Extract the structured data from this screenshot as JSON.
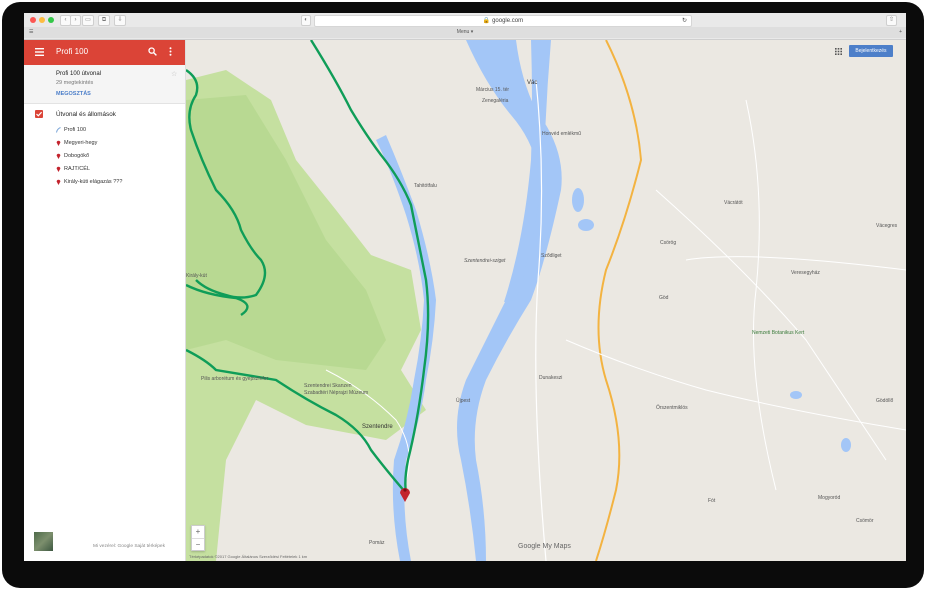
{
  "browser": {
    "url": "google.com",
    "tab_label": "Menu ▾",
    "tab_icon": "sidebar-icon"
  },
  "sidebar": {
    "title": "Profi 100",
    "map_title": "Profi 100 útvonal",
    "views": "29 megtekintés",
    "share": "MEGOSZTÁS",
    "layer_title": "Útvonal és állomások",
    "items": [
      {
        "label": "Profi 100",
        "icon": "route-icon"
      },
      {
        "label": "Megyeri-hegy",
        "icon": "pin-icon"
      },
      {
        "label": "Dobogókő",
        "icon": "pin-icon"
      },
      {
        "label": "RAJT/CÉL",
        "icon": "pin-icon"
      },
      {
        "label": "Király-kúti elágazás ???",
        "icon": "pin-icon"
      }
    ],
    "footer": "Mi vezérel: Google Saját térképek"
  },
  "map": {
    "signin": "Bejelentkezés",
    "branding": "Google My Maps",
    "attribution": "Térképadatok ©2017 Google   Általános Szerződési Feltételek   1 km",
    "labels": {
      "vac": "Vác",
      "marcius": "Március 15. tér",
      "zenegalerian": "Zenegaléria",
      "honved": "Honvéd emlékmű",
      "tahitotfalu": "Tahitótfalu",
      "szentendrei_sziget": "Szentendrei-sziget",
      "szodliget": "Sződliget",
      "veresegyhaz": "Veresegyház",
      "csoerog": "Csörög",
      "vacratot": "Vácrátót",
      "vacegres": "Vácegres",
      "god": "Göd",
      "vacratot_kert": "Nemzeti Botanikus Kert",
      "szentendre": "Szentendre",
      "skanzen": "Szentendrei Skanzen",
      "szentendrei_muzeum": "Szabadtéri Néprajzi Múzeum",
      "dunakeszi": "Dunakeszi",
      "gödöllő": "Gödöllő",
      "fot": "Fót",
      "mogyorod": "Mogyoród",
      "csomor": "Csömör",
      "pomaz": "Pomáz",
      "kiralykut": "Király-kút",
      "arboretum": "Pilis arborétum és gyepszínfer",
      "ujpest": "Újpest",
      "sodlig": "Őrszentmiklós"
    }
  },
  "colors": {
    "header_red": "#db4437",
    "route_green": "#0f9d58",
    "river_blue": "#a3c6f7",
    "forest": "#b8d992",
    "highway_orange": "#f3b341",
    "signin_blue": "#4d7fc9"
  }
}
